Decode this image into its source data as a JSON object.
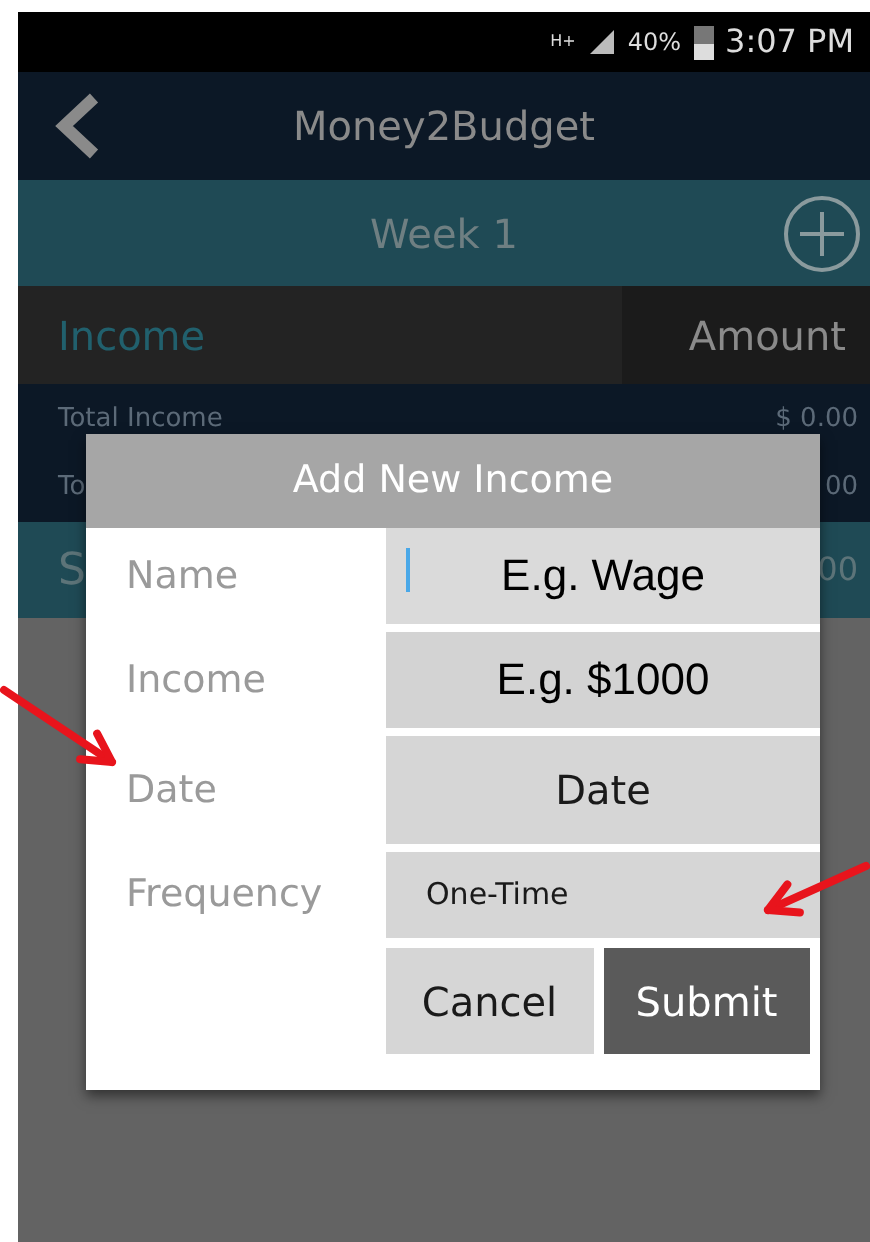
{
  "status_bar": {
    "network": "H+",
    "battery": "40%",
    "time": "3:07 PM"
  },
  "app_bar": {
    "title": "Money2Budget"
  },
  "week_bar": {
    "title": "Week 1"
  },
  "table": {
    "columns": [
      "Income",
      "Amount"
    ],
    "rows": [
      {
        "label": "Total Income",
        "amount": "$ 0.00"
      },
      {
        "label": "To",
        "amount": "00"
      }
    ],
    "summary": {
      "label": "S",
      "amount": "00"
    }
  },
  "dialog": {
    "title": "Add New Income",
    "fields": [
      {
        "label": "Name",
        "kind": "text",
        "placeholder": "E.g. Wage",
        "focused": true
      },
      {
        "label": "Income",
        "kind": "text",
        "placeholder": "E.g. $1000",
        "focused": false
      },
      {
        "label": "Date",
        "kind": "button",
        "value": "Date"
      },
      {
        "label": "Frequency",
        "kind": "select",
        "value": "One-Time"
      }
    ],
    "buttons": [
      {
        "label": "Cancel",
        "kind": "secondary"
      },
      {
        "label": "Submit",
        "kind": "primary"
      }
    ]
  }
}
